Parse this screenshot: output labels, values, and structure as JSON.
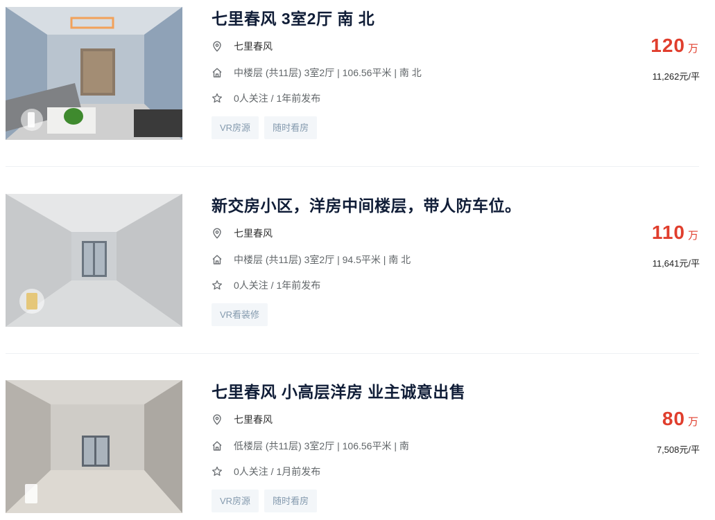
{
  "colors": {
    "price": "#e03e2d",
    "title": "#101d37",
    "tag_bg": "#f3f6f9",
    "tag_text": "#849aae"
  },
  "icons": {
    "location": "location-pin-icon",
    "house": "house-icon",
    "follow": "star-icon"
  },
  "listings": [
    {
      "title": "七里春风 3室2厅 南 北",
      "community": "七里春风",
      "info": "中楼层 (共11层) 3室2厅 | 106.56平米 | 南 北",
      "follow": "0人关注 / 1年前发布",
      "tags": [
        "VR房源",
        "随时看房"
      ],
      "price": "120",
      "price_unit": "万",
      "unit_price": "11,262元/平"
    },
    {
      "title": "新交房小区，洋房中间楼层，带人防车位。",
      "community": "七里春风",
      "info": "中楼层 (共11层) 3室2厅 | 94.5平米 | 南 北",
      "follow": "0人关注 / 1年前发布",
      "tags": [
        "VR看装修"
      ],
      "price": "110",
      "price_unit": "万",
      "unit_price": "11,641元/平"
    },
    {
      "title": "七里春风 小高层洋房 业主诚意出售",
      "community": "七里春风",
      "info": "低楼层 (共11层) 3室2厅 | 106.56平米 | 南",
      "follow": "0人关注 / 1月前发布",
      "tags": [
        "VR房源",
        "随时看房"
      ],
      "price": "80",
      "price_unit": "万",
      "unit_price": "7,508元/平"
    }
  ]
}
